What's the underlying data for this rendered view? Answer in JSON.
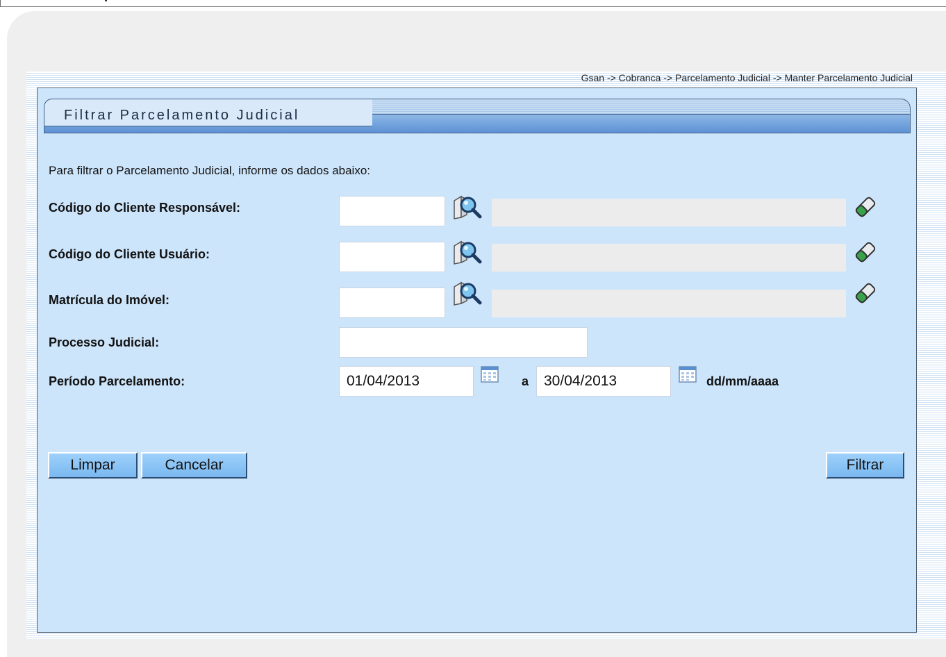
{
  "breadcrumb": "Gsan -> Cobranca -> Parcelamento Judicial -> Manter Parcelamento Judicial",
  "panel": {
    "title": "Filtrar Parcelamento Judicial"
  },
  "form": {
    "instruction": "Para filtrar o Parcelamento Judicial, informe os dados abaixo:",
    "cliente_responsavel": {
      "label": "Código do Cliente Responsável:",
      "value": "",
      "description": ""
    },
    "cliente_usuario": {
      "label": "Código do Cliente Usuário:",
      "value": "",
      "description": ""
    },
    "matricula_imovel": {
      "label": "Matrícula do Imóvel:",
      "value": "",
      "description": ""
    },
    "processo_judicial": {
      "label": "Processo Judicial:",
      "value": ""
    },
    "periodo": {
      "label": "Período Parcelamento:",
      "inicio": "01/04/2013",
      "separator": "a",
      "fim": "30/04/2013",
      "format_hint": "dd/mm/aaaa"
    }
  },
  "buttons": {
    "limpar": "Limpar",
    "cancelar": "Cancelar",
    "filtrar": "Filtrar"
  },
  "icons": {
    "search": "magnifier-search-icon",
    "clear": "eraser-icon",
    "calendar": "calendar-icon"
  },
  "colors": {
    "panel_background": "#cde5fb",
    "button_background": "#8cc4f5",
    "title_bar": "#5d92d4"
  }
}
